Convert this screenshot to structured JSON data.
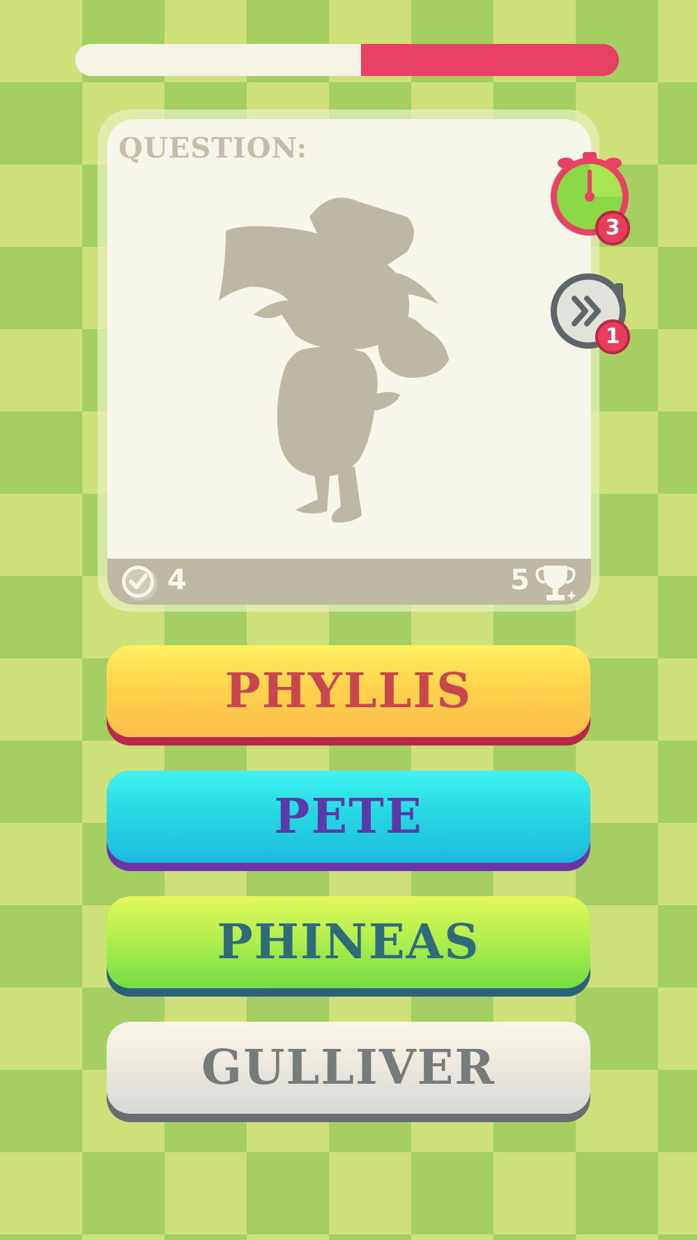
{
  "timer_progress": {
    "remaining_fraction": 0.475,
    "track_color": "#f4f3e6",
    "fill_color": "#e84263"
  },
  "question": {
    "label": "QUESTION:",
    "image": "character-silhouette"
  },
  "stats": {
    "correct_answers": "4",
    "best_score": "5"
  },
  "powerups": [
    {
      "name": "extra-time",
      "icon": "stopwatch-icon",
      "count": "3"
    },
    {
      "name": "skip-question",
      "icon": "fast-forward-icon",
      "count": "1"
    }
  ],
  "answers": [
    {
      "label": "PHYLLIS",
      "color": "#ffd34e"
    },
    {
      "label": "PETE",
      "color": "#27d8e2"
    },
    {
      "label": "PHINEAS",
      "color": "#b3ef4e"
    },
    {
      "label": "GULLIVER",
      "color": "#eee9dd"
    }
  ]
}
